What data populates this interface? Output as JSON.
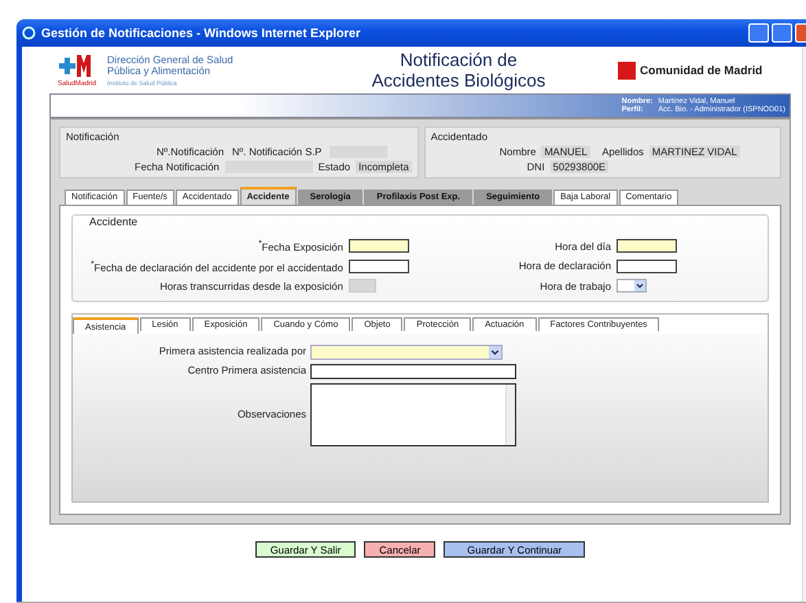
{
  "window": {
    "title": "Gestión de Notificaciones - Windows Internet Explorer"
  },
  "header": {
    "org_lines": [
      "Dirección General de Salud",
      "Pública y Alimentación"
    ],
    "brand": "SaludMadrid",
    "institute": "Instituto de Salud Pública",
    "title": "Notificación de Accidentes Biológicos",
    "region": "Comunidad de Madrid"
  },
  "user_bar": {
    "name_label": "Nombre:",
    "name": "Martinez Vidal, Manuel",
    "profile_label": "Perfil:",
    "profile": "Acc. Bio. - Administrador (ISPNOD01)"
  },
  "notification": {
    "title": "Notificación",
    "number_label": "Nº.Notificación",
    "sp_label": "Nº. Notificación S.P",
    "date_label": "Fecha Notificación",
    "state_label": "Estado",
    "state": "Incompleta"
  },
  "injured": {
    "title": "Accidentado",
    "name_label": "Nombre",
    "name": "MANUEL",
    "surname_label": "Apellidos",
    "surname": "MARTINEZ VIDAL",
    "dni_label": "DNI",
    "dni": "50293800E"
  },
  "tabs": [
    {
      "label": "Notificación",
      "selected": false,
      "shaded": false
    },
    {
      "label": "Fuente/s",
      "selected": false,
      "shaded": false
    },
    {
      "label": "Accidentado",
      "selected": false,
      "shaded": false
    },
    {
      "label": "Accidente",
      "selected": true,
      "shaded": false
    },
    {
      "label": "Serologia",
      "selected": false,
      "shaded": true
    },
    {
      "label": "Profilaxis Post Exp.",
      "selected": false,
      "shaded": true
    },
    {
      "label": "Seguimiento",
      "selected": false,
      "shaded": true
    },
    {
      "label": "Baja Laboral",
      "selected": false,
      "shaded": false
    },
    {
      "label": "Comentario",
      "selected": false,
      "shaded": false
    }
  ],
  "accident": {
    "legend": "Accidente",
    "left_fields": [
      {
        "label": "$^{*}$Fecha Exposición",
        "kind": "required"
      },
      {
        "label": "$^{*}$Fecha de declaración del accidente por el accidentado",
        "kind": "text"
      },
      {
        "label": "Horas transcurridas desde la exposición",
        "kind": "readonly"
      }
    ],
    "right_fields": [
      {
        "label": "Hora del día",
        "kind": "required"
      },
      {
        "label": "Hora de declaración",
        "kind": "text"
      },
      {
        "label": "Hora de trabajo",
        "kind": "select"
      }
    ]
  },
  "subtabs": [
    {
      "label": "Asistencia",
      "selected": true
    },
    {
      "label": "Lesión",
      "selected": false
    },
    {
      "label": "Exposición",
      "selected": false
    },
    {
      "label": "Cuando y Cómo",
      "selected": false
    },
    {
      "label": "Objeto",
      "selected": false
    },
    {
      "label": "Protección",
      "selected": false
    },
    {
      "label": "Actuación",
      "selected": false
    },
    {
      "label": "Factores Contribuyentes",
      "selected": false
    }
  ],
  "assistance": [
    {
      "label": "Primera asistencia realizada por",
      "kind": "select"
    },
    {
      "label": "Centro Primera asistencia",
      "kind": "text"
    },
    {
      "label": "Observaciones",
      "kind": "textarea"
    }
  ],
  "buttons": [
    {
      "label": "Guardar Y Salir",
      "kind": "save"
    },
    {
      "label": "Cancelar",
      "kind": "cancel"
    },
    {
      "label": "Guardar Y Continuar",
      "kind": "continue"
    }
  ]
}
